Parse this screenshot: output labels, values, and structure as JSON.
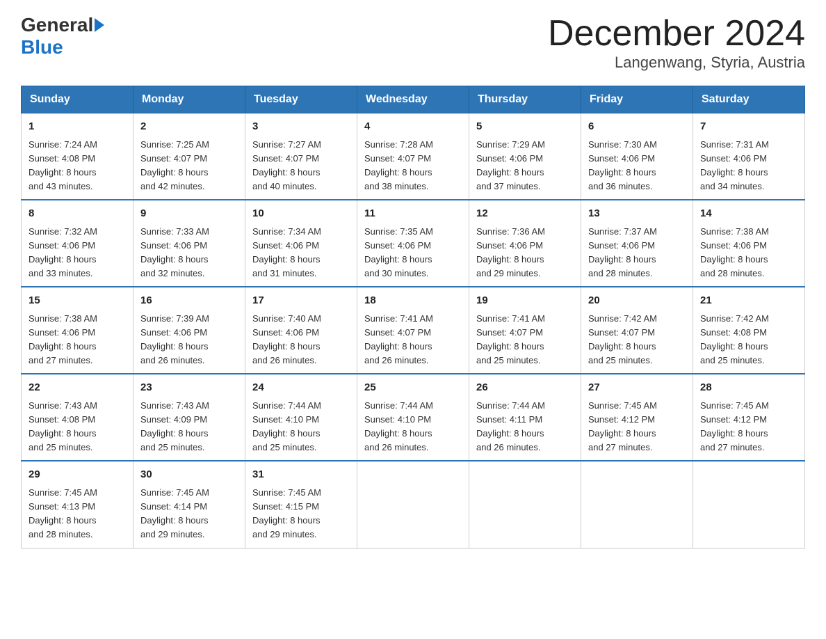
{
  "header": {
    "logo_general": "General",
    "logo_blue": "Blue",
    "title": "December 2024",
    "subtitle": "Langenwang, Styria, Austria"
  },
  "days_of_week": [
    "Sunday",
    "Monday",
    "Tuesday",
    "Wednesday",
    "Thursday",
    "Friday",
    "Saturday"
  ],
  "weeks": [
    [
      {
        "day": "1",
        "sunrise": "7:24 AM",
        "sunset": "4:08 PM",
        "daylight": "8 hours and 43 minutes."
      },
      {
        "day": "2",
        "sunrise": "7:25 AM",
        "sunset": "4:07 PM",
        "daylight": "8 hours and 42 minutes."
      },
      {
        "day": "3",
        "sunrise": "7:27 AM",
        "sunset": "4:07 PM",
        "daylight": "8 hours and 40 minutes."
      },
      {
        "day": "4",
        "sunrise": "7:28 AM",
        "sunset": "4:07 PM",
        "daylight": "8 hours and 38 minutes."
      },
      {
        "day": "5",
        "sunrise": "7:29 AM",
        "sunset": "4:06 PM",
        "daylight": "8 hours and 37 minutes."
      },
      {
        "day": "6",
        "sunrise": "7:30 AM",
        "sunset": "4:06 PM",
        "daylight": "8 hours and 36 minutes."
      },
      {
        "day": "7",
        "sunrise": "7:31 AM",
        "sunset": "4:06 PM",
        "daylight": "8 hours and 34 minutes."
      }
    ],
    [
      {
        "day": "8",
        "sunrise": "7:32 AM",
        "sunset": "4:06 PM",
        "daylight": "8 hours and 33 minutes."
      },
      {
        "day": "9",
        "sunrise": "7:33 AM",
        "sunset": "4:06 PM",
        "daylight": "8 hours and 32 minutes."
      },
      {
        "day": "10",
        "sunrise": "7:34 AM",
        "sunset": "4:06 PM",
        "daylight": "8 hours and 31 minutes."
      },
      {
        "day": "11",
        "sunrise": "7:35 AM",
        "sunset": "4:06 PM",
        "daylight": "8 hours and 30 minutes."
      },
      {
        "day": "12",
        "sunrise": "7:36 AM",
        "sunset": "4:06 PM",
        "daylight": "8 hours and 29 minutes."
      },
      {
        "day": "13",
        "sunrise": "7:37 AM",
        "sunset": "4:06 PM",
        "daylight": "8 hours and 28 minutes."
      },
      {
        "day": "14",
        "sunrise": "7:38 AM",
        "sunset": "4:06 PM",
        "daylight": "8 hours and 28 minutes."
      }
    ],
    [
      {
        "day": "15",
        "sunrise": "7:38 AM",
        "sunset": "4:06 PM",
        "daylight": "8 hours and 27 minutes."
      },
      {
        "day": "16",
        "sunrise": "7:39 AM",
        "sunset": "4:06 PM",
        "daylight": "8 hours and 26 minutes."
      },
      {
        "day": "17",
        "sunrise": "7:40 AM",
        "sunset": "4:06 PM",
        "daylight": "8 hours and 26 minutes."
      },
      {
        "day": "18",
        "sunrise": "7:41 AM",
        "sunset": "4:07 PM",
        "daylight": "8 hours and 26 minutes."
      },
      {
        "day": "19",
        "sunrise": "7:41 AM",
        "sunset": "4:07 PM",
        "daylight": "8 hours and 25 minutes."
      },
      {
        "day": "20",
        "sunrise": "7:42 AM",
        "sunset": "4:07 PM",
        "daylight": "8 hours and 25 minutes."
      },
      {
        "day": "21",
        "sunrise": "7:42 AM",
        "sunset": "4:08 PM",
        "daylight": "8 hours and 25 minutes."
      }
    ],
    [
      {
        "day": "22",
        "sunrise": "7:43 AM",
        "sunset": "4:08 PM",
        "daylight": "8 hours and 25 minutes."
      },
      {
        "day": "23",
        "sunrise": "7:43 AM",
        "sunset": "4:09 PM",
        "daylight": "8 hours and 25 minutes."
      },
      {
        "day": "24",
        "sunrise": "7:44 AM",
        "sunset": "4:10 PM",
        "daylight": "8 hours and 25 minutes."
      },
      {
        "day": "25",
        "sunrise": "7:44 AM",
        "sunset": "4:10 PM",
        "daylight": "8 hours and 26 minutes."
      },
      {
        "day": "26",
        "sunrise": "7:44 AM",
        "sunset": "4:11 PM",
        "daylight": "8 hours and 26 minutes."
      },
      {
        "day": "27",
        "sunrise": "7:45 AM",
        "sunset": "4:12 PM",
        "daylight": "8 hours and 27 minutes."
      },
      {
        "day": "28",
        "sunrise": "7:45 AM",
        "sunset": "4:12 PM",
        "daylight": "8 hours and 27 minutes."
      }
    ],
    [
      {
        "day": "29",
        "sunrise": "7:45 AM",
        "sunset": "4:13 PM",
        "daylight": "8 hours and 28 minutes."
      },
      {
        "day": "30",
        "sunrise": "7:45 AM",
        "sunset": "4:14 PM",
        "daylight": "8 hours and 29 minutes."
      },
      {
        "day": "31",
        "sunrise": "7:45 AM",
        "sunset": "4:15 PM",
        "daylight": "8 hours and 29 minutes."
      },
      null,
      null,
      null,
      null
    ]
  ],
  "labels": {
    "sunrise": "Sunrise:",
    "sunset": "Sunset:",
    "daylight": "Daylight:"
  }
}
